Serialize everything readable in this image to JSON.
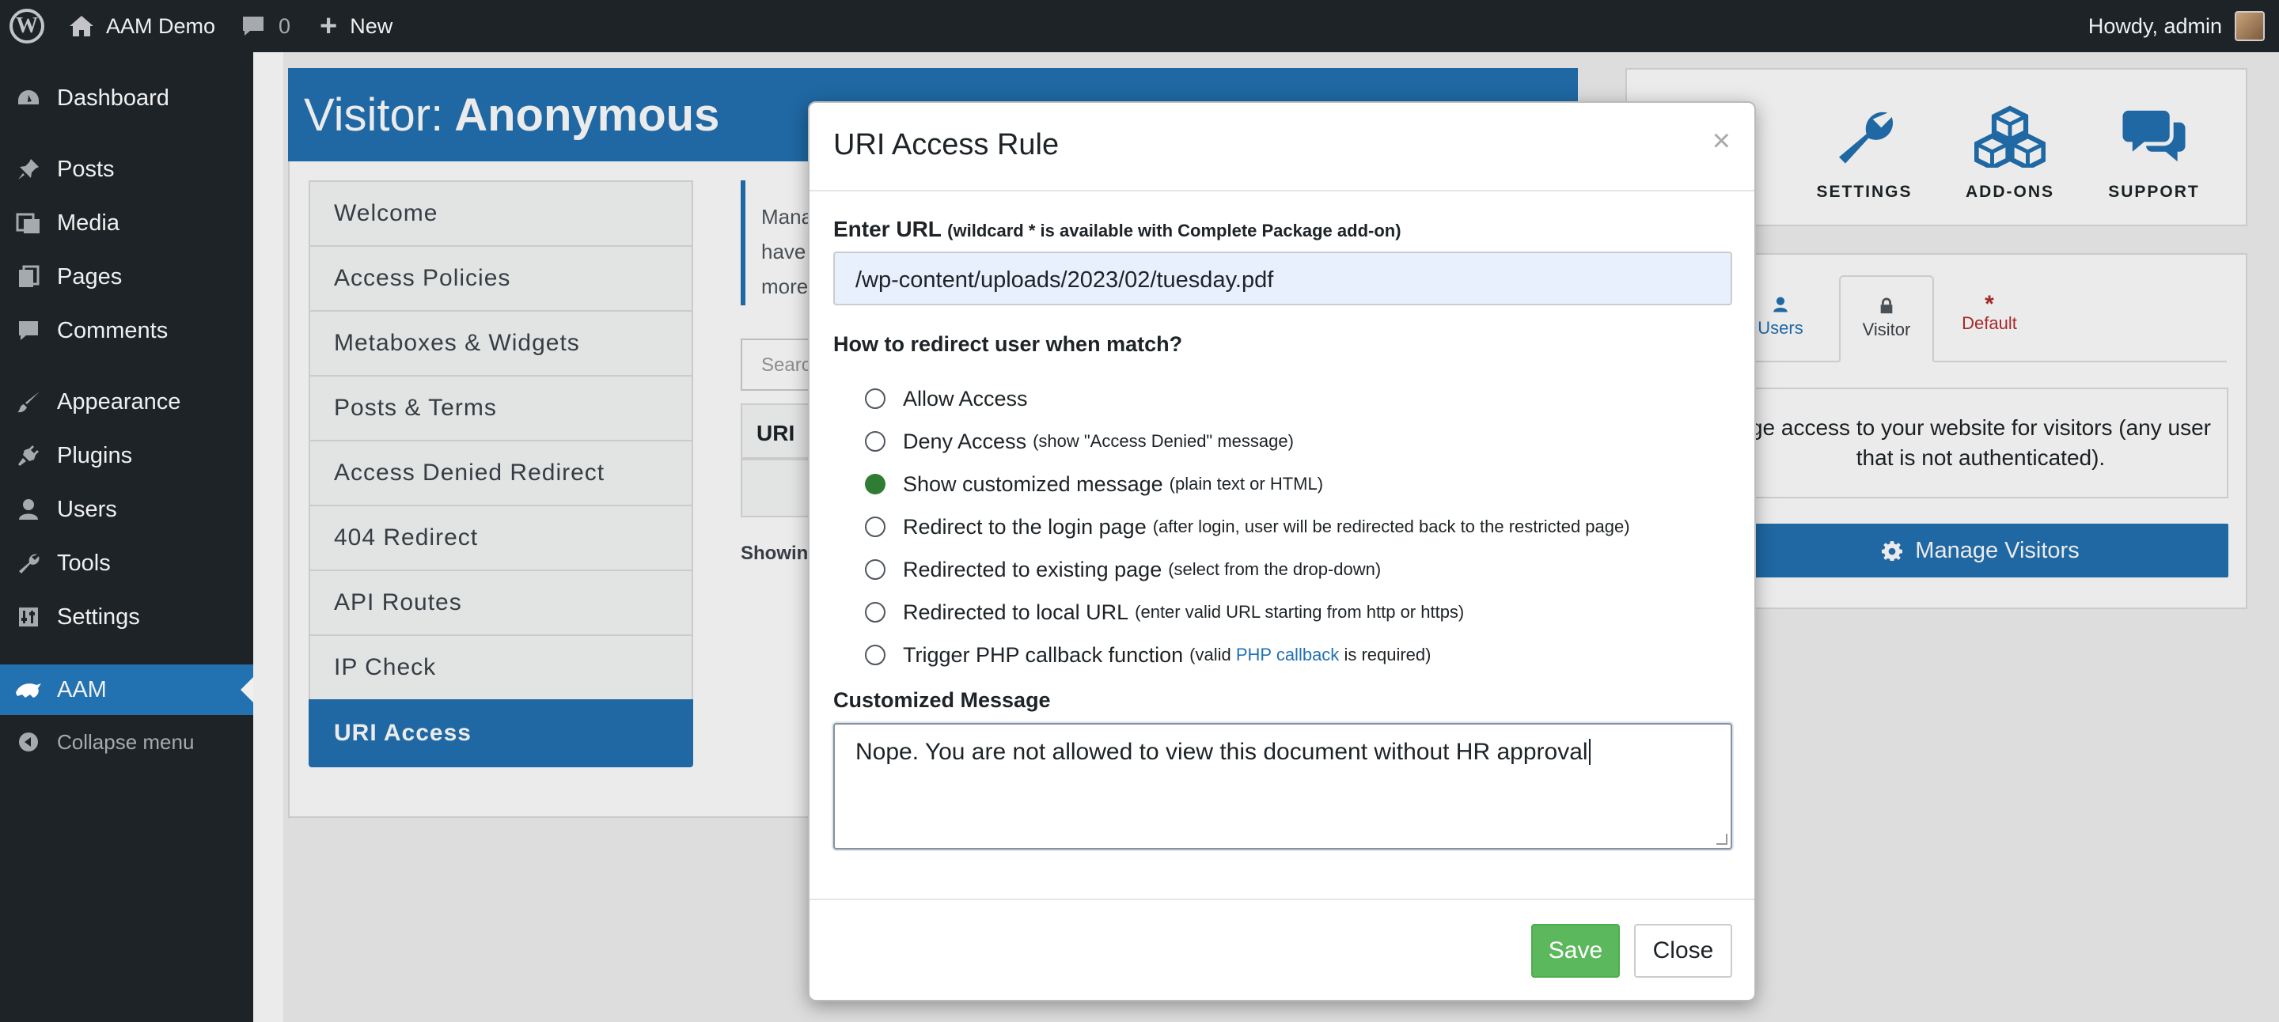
{
  "adminbar": {
    "site_name": "AAM Demo",
    "comments_count": "0",
    "new_label": "New",
    "howdy": "Howdy, admin"
  },
  "sidebar": {
    "items": [
      {
        "label": "Dashboard",
        "icon": "dashboard-icon"
      },
      {
        "label": "Posts",
        "icon": "pin-icon"
      },
      {
        "label": "Media",
        "icon": "media-icon"
      },
      {
        "label": "Pages",
        "icon": "pages-icon"
      },
      {
        "label": "Comments",
        "icon": "comment-icon"
      },
      {
        "label": "Appearance",
        "icon": "brush-icon"
      },
      {
        "label": "Plugins",
        "icon": "plug-icon"
      },
      {
        "label": "Users",
        "icon": "user-icon"
      },
      {
        "label": "Tools",
        "icon": "wrench-icon"
      },
      {
        "label": "Settings",
        "icon": "settings-icon"
      },
      {
        "label": "AAM",
        "icon": "aam-icon"
      }
    ],
    "collapse_label": "Collapse menu"
  },
  "main": {
    "visitor_prefix": "Visitor:",
    "visitor_name": "Anonymous",
    "tabs": [
      "Welcome",
      "Access Policies",
      "Metaboxes & Widgets",
      "Posts & Terms",
      "Access Denied Redirect",
      "404 Redirect",
      "API Routes",
      "IP Check",
      "URI Access"
    ],
    "notice_lines": [
      "Mana",
      "have",
      "more"
    ],
    "search_placeholder": "Searc",
    "table_header": "URI",
    "showing": "Showing"
  },
  "right_panel": {
    "buttons": [
      "SETTINGS",
      "ADD-ONS",
      "SUPPORT"
    ],
    "tabs": [
      "Users",
      "Visitor",
      "Default"
    ],
    "description": "ge access to your website for visitors (any user that is not authenticated).",
    "manage_label": "Manage Visitors"
  },
  "modal": {
    "title": "URI Access Rule",
    "close_x": "×",
    "url_label": "Enter URL",
    "url_hint": "(wildcard * is available with Complete Package add-on)",
    "url_value": "/wp-content/uploads/2023/02/tuesday.pdf",
    "redirect_label": "How to redirect user when match?",
    "options": [
      {
        "label": "Allow Access",
        "hint": ""
      },
      {
        "label": "Deny Access",
        "hint": "(show \"Access Denied\" message)"
      },
      {
        "label": "Show customized message",
        "hint": "(plain text or HTML)"
      },
      {
        "label": "Redirect to the login page",
        "hint": "(after login, user will be redirected back to the restricted page)"
      },
      {
        "label": "Redirected to existing page",
        "hint": "(select from the drop-down)"
      },
      {
        "label": "Redirected to local URL",
        "hint": "(enter valid URL starting from http or https)"
      },
      {
        "label": "Trigger PHP callback function",
        "hint_pre": "(valid",
        "hint_link": "PHP callback",
        "hint_post": "is required)"
      }
    ],
    "selected_option": 2,
    "message_label": "Customized Message",
    "message_value": "Nope. You are not allowed to view this document without HR approval",
    "save_label": "Save",
    "close_label": "Close",
    "colors": {
      "save": "#5cb85c",
      "accent": "#2271b1",
      "selected_radio": "#2e7d32"
    }
  }
}
